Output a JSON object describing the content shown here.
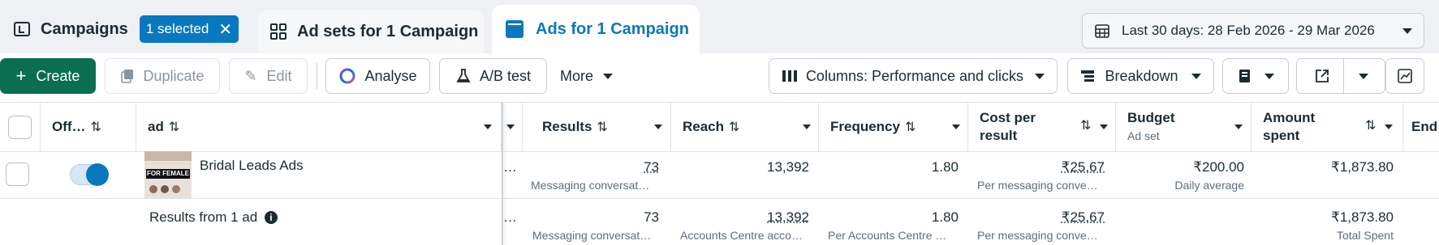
{
  "tabs": {
    "campaigns": "Campaigns",
    "selected": "1 selected",
    "adsets": "Ad sets for 1 Campaign",
    "ads": "Ads for 1 Campaign"
  },
  "date_range": "Last 30 days: 28 Feb 2026 - 29 Mar 2026",
  "toolbar": {
    "create": "Create",
    "duplicate": "Duplicate",
    "edit": "Edit",
    "analyse": "Analyse",
    "ab_test": "A/B test",
    "more": "More",
    "columns": "Columns: Performance and clicks",
    "breakdown": "Breakdown"
  },
  "headers": {
    "off": "Off…",
    "ad": "ad",
    "results": "Results",
    "reach": "Reach",
    "frequency": "Frequency",
    "cost_per_result_1": "Cost per",
    "cost_per_result_2": "result",
    "budget": "Budget",
    "budget_sub": "Ad set",
    "amount_spent_1": "Amount",
    "amount_spent_2": "spent",
    "ends": "End"
  },
  "row": {
    "name": "Bridal Leads Ads",
    "thumb_text": "FOR FEMALE",
    "results": "73",
    "results_sub": "Messaging conversat…",
    "reach": "13,392",
    "frequency": "1.80",
    "cost": "₹25.67",
    "cost_sub": "Per messaging conve…",
    "budget": "₹200.00",
    "budget_sub": "Daily average",
    "spent": "₹1,873.80",
    "ellipsis": "…"
  },
  "summary": {
    "label": "Results from 1 ad",
    "results": "73",
    "results_sub": "Messaging conversat…",
    "reach": "13,392",
    "reach_sub": "Accounts Centre acco…",
    "frequency": "1.80",
    "frequency_sub": "Per Accounts Centre …",
    "cost": "₹25.67",
    "cost_sub": "Per messaging conve…",
    "spent": "₹1,873.80",
    "spent_sub": "Total Spent",
    "ellipsis": "…"
  },
  "colors": {
    "accent": "#0a78be",
    "create": "#0b6e4f",
    "toggle": "#0a78be"
  }
}
